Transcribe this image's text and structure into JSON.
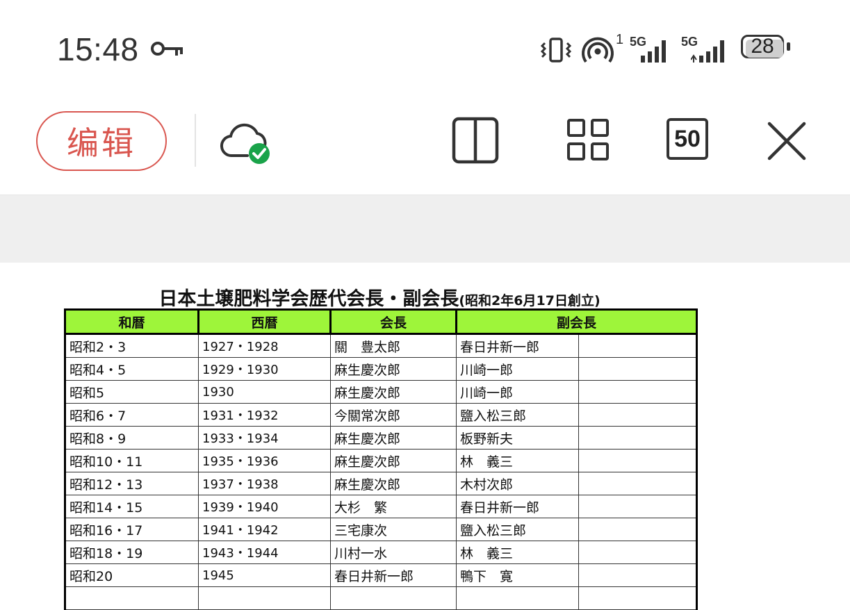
{
  "status_bar": {
    "time": "15:48",
    "network_1": "5G",
    "network_2": "5G",
    "hotspot_sup": "1",
    "battery": "28"
  },
  "toolbar": {
    "edit_label": "编辑",
    "zoom_label": "50",
    "accent_color": "#d9564f",
    "sync_color": "#1aa34a",
    "icons": [
      "key-icon",
      "vibrate-icon",
      "hotspot-icon",
      "signal-icon",
      "battery-icon",
      "cloud-sync-icon",
      "split-view-icon",
      "grid-view-icon",
      "zoom-icon",
      "close-icon"
    ]
  },
  "document": {
    "title_main": "日本土壌肥料学会歴代会長・副会長",
    "title_sub": "(昭和2年6月17日創立)",
    "header_color": "#9ef53a",
    "columns": [
      "和暦",
      "西暦",
      "会長",
      "副会長"
    ],
    "rows": [
      {
        "wareki": "昭和2・3",
        "seireki": "1927・1928",
        "president": "關　豊太郎",
        "vice": "春日井新一郎",
        "extra": ""
      },
      {
        "wareki": "昭和4・5",
        "seireki": "1929・1930",
        "president": "麻生慶次郎",
        "vice": "川崎一郎",
        "extra": ""
      },
      {
        "wareki": "昭和5",
        "seireki": "1930",
        "president": "麻生慶次郎",
        "vice": "川崎一郎",
        "extra": ""
      },
      {
        "wareki": "昭和6・7",
        "seireki": "1931・1932",
        "president": "今關常次郎",
        "vice": "鹽入松三郎",
        "extra": ""
      },
      {
        "wareki": "昭和8・9",
        "seireki": "1933・1934",
        "president": "麻生慶次郎",
        "vice": "板野新夫",
        "extra": ""
      },
      {
        "wareki": "昭和10・11",
        "seireki": "1935・1936",
        "president": "麻生慶次郎",
        "vice": "林　義三",
        "extra": ""
      },
      {
        "wareki": "昭和12・13",
        "seireki": "1937・1938",
        "president": "麻生慶次郎",
        "vice": "木村次郎",
        "extra": ""
      },
      {
        "wareki": "昭和14・15",
        "seireki": "1939・1940",
        "president": "大杉　繁",
        "vice": "春日井新一郎",
        "extra": ""
      },
      {
        "wareki": "昭和16・17",
        "seireki": "1941・1942",
        "president": "三宅康次",
        "vice": "鹽入松三郎",
        "extra": ""
      },
      {
        "wareki": "昭和18・19",
        "seireki": "1943・1944",
        "president": "川村一水",
        "vice": "林　義三",
        "extra": ""
      },
      {
        "wareki": "昭和20",
        "seireki": "1945",
        "president": "春日井新一郎",
        "vice": "鴨下　寛",
        "extra": ""
      },
      {
        "wareki": "",
        "seireki": "",
        "president": "",
        "vice": "",
        "extra": ""
      }
    ]
  }
}
